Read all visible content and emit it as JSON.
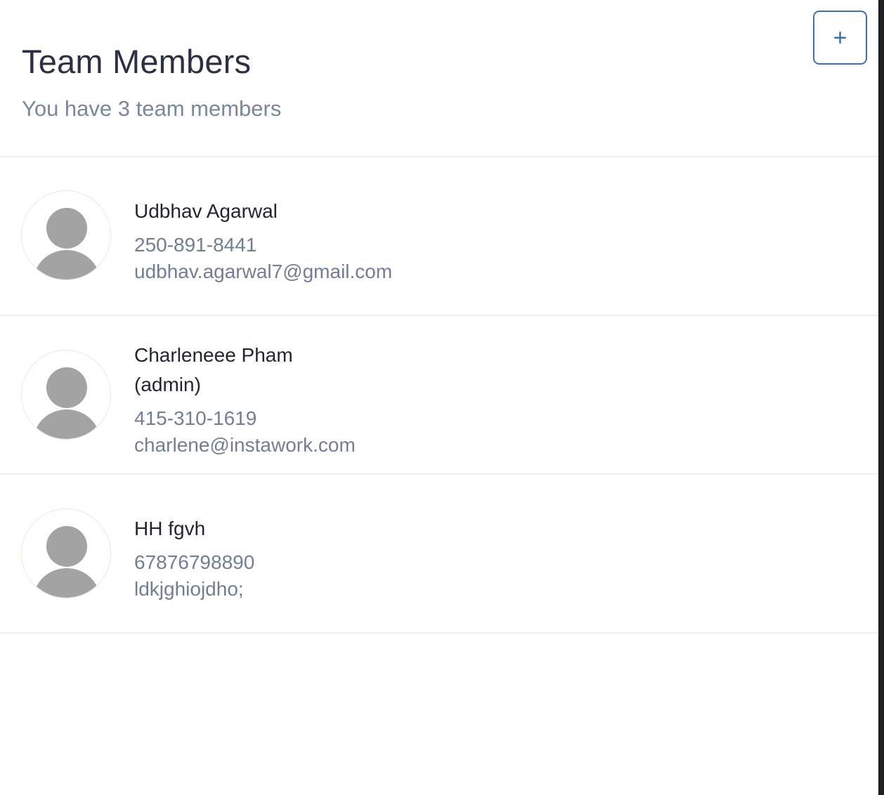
{
  "header": {
    "title": "Team Members",
    "subtitle": "You have 3 team members",
    "add_label": "+"
  },
  "colors": {
    "accent": "#3f6fa3",
    "title": "#2b3140",
    "muted": "#7a8699",
    "avatar_placeholder": "#a3a3a3",
    "divider": "#eef0f4"
  },
  "members": [
    {
      "name": "Udbhav Agarwal",
      "phone": "250-891-8441",
      "email": "udbhav.agarwal7@gmail.com"
    },
    {
      "name": "Charleneee Pham (admin)",
      "phone": "415-310-1619",
      "email": "charlene@instawork.com"
    },
    {
      "name": "HH fgvh",
      "phone": "67876798890",
      "email": "ldkjghiojdho;"
    }
  ]
}
